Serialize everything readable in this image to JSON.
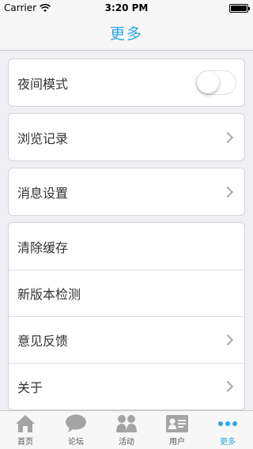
{
  "status_bar": {
    "carrier": "Carrier",
    "time": "3:20 PM"
  },
  "nav": {
    "title": "更多"
  },
  "settings_groups": [
    [
      {
        "label": "夜间模式",
        "accessory": "switch",
        "switch_on": false
      }
    ],
    [
      {
        "label": "浏览记录",
        "accessory": "chevron"
      }
    ],
    [
      {
        "label": "消息设置",
        "accessory": "chevron"
      }
    ],
    [
      {
        "label": "清除缓存",
        "accessory": "none"
      },
      {
        "label": "新版本检测",
        "accessory": "none"
      },
      {
        "label": "意见反馈",
        "accessory": "chevron"
      },
      {
        "label": "关于",
        "accessory": "chevron"
      }
    ]
  ],
  "tabbar": {
    "items": [
      {
        "label": "首页",
        "icon": "home-icon"
      },
      {
        "label": "论坛",
        "icon": "chat-bubble-icon"
      },
      {
        "label": "活动",
        "icon": "group-icon"
      },
      {
        "label": "用户",
        "icon": "id-card-icon"
      },
      {
        "label": "更多",
        "icon": "more-dots-icon",
        "active": true
      }
    ]
  },
  "colors": {
    "accent": "#29a6e6",
    "icon_gray": "#a4a4a4",
    "background": "#efeff4"
  }
}
